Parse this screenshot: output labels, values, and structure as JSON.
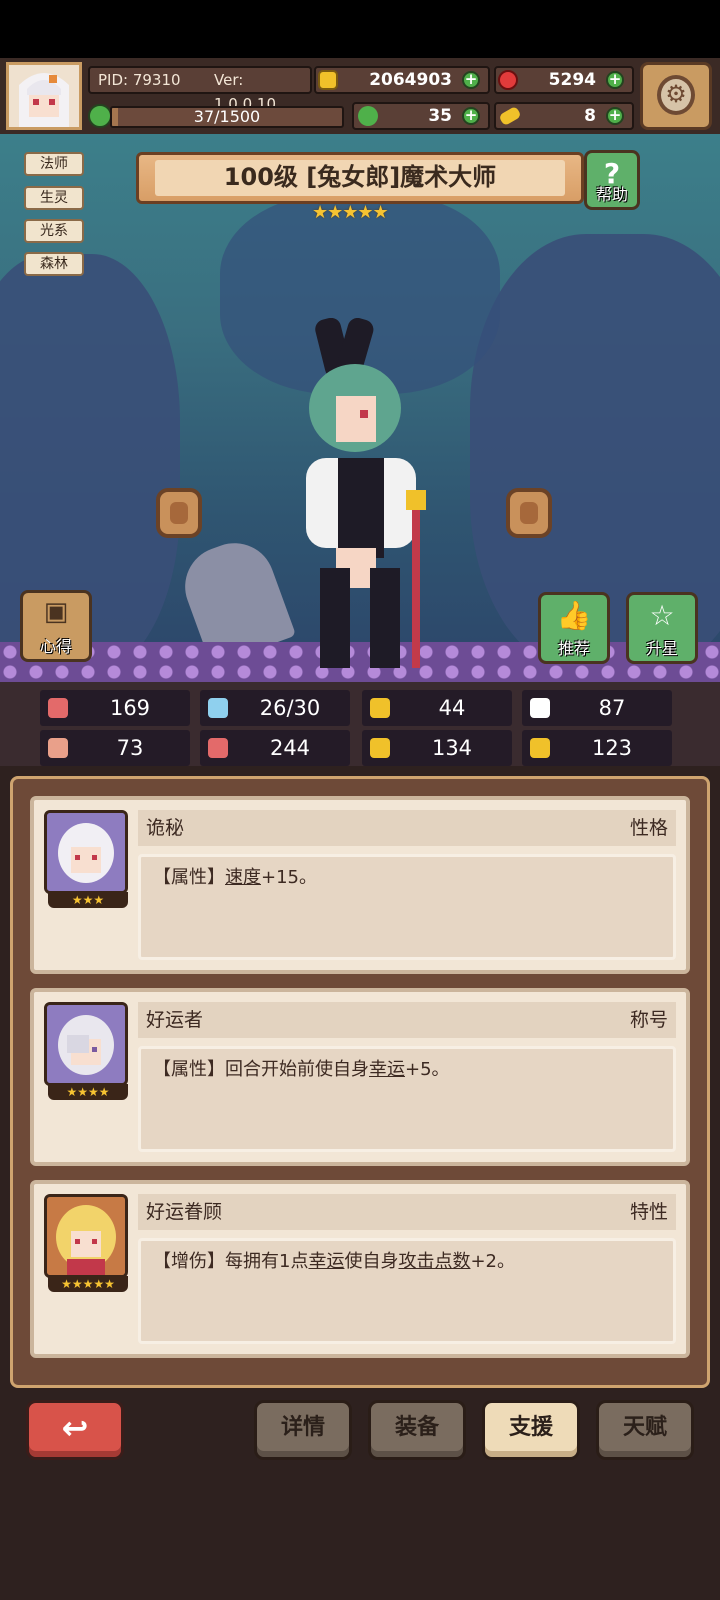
{
  "header": {
    "pid": "PID: 79310",
    "version": "Ver: 1.0.0.10",
    "gold": "2064903",
    "gems": "5294",
    "energy": "37/1500",
    "energy_fraction": 0.025,
    "clover": "35",
    "keys": "8",
    "colors": {
      "gold": "#f0c12a",
      "gem": "#e23b3b",
      "energy": "#4fb04a",
      "key": "#f0c12a"
    }
  },
  "tags": [
    "法师",
    "生灵",
    "光系",
    "森林"
  ],
  "hero": {
    "title": "100级 [兔女郎]魔术大师",
    "stars": "★★★★★",
    "star_count": 5
  },
  "buttons": {
    "help": "帮助",
    "help_symbol": "?",
    "notes": "心得",
    "recommend": "推荐",
    "star_up": "升星"
  },
  "stats": [
    {
      "icon": "heart-icon",
      "value": "169",
      "color": "#e36a6a"
    },
    {
      "icon": "water-drop-icon",
      "value": "26/30",
      "color": "#8fd0ee"
    },
    {
      "icon": "shield-icon",
      "value": "44",
      "color": "#f0c12a"
    },
    {
      "icon": "wing-icon",
      "value": "87",
      "color": "#ffffff"
    },
    {
      "icon": "fist-icon",
      "value": "73",
      "color": "#e9a08a"
    },
    {
      "icon": "book-icon",
      "value": "244",
      "color": "#e36a6a"
    },
    {
      "icon": "boot-icon",
      "value": "134",
      "color": "#f0c12a"
    },
    {
      "icon": "horseshoe-icon",
      "value": "123",
      "color": "#f0c12a"
    }
  ],
  "cards": [
    {
      "name": "诡秘",
      "type": "性格",
      "stars": "★★★",
      "desc_prefix": "【属性】",
      "desc_parts": [
        "速度",
        "+15。"
      ]
    },
    {
      "name": "好运者",
      "type": "称号",
      "stars": "★★★★",
      "desc_prefix": "【属性】回合开始前使自身",
      "desc_parts": [
        "幸运",
        "+5。"
      ]
    },
    {
      "name": "好运眷顾",
      "type": "特性",
      "stars": "★★★★★",
      "desc_prefix": "【增伤】每拥有1点",
      "desc_parts": [
        "幸运",
        "使自身",
        "攻击点数",
        "+2。"
      ]
    }
  ],
  "bottom": {
    "back_symbol": "↩",
    "tabs": [
      "详情",
      "装备",
      "支援",
      "天赋"
    ],
    "active_tab": "支援"
  }
}
